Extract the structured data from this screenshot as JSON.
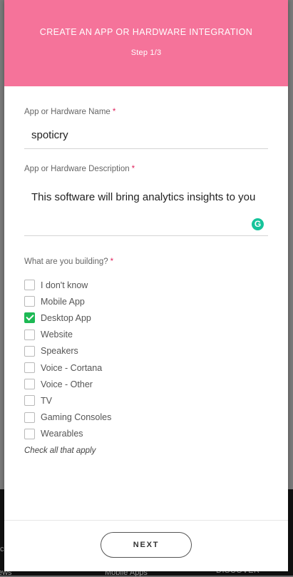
{
  "modal": {
    "title": "CREATE AN APP OR HARDWARE INTEGRATION",
    "step": "Step 1/3"
  },
  "name_field": {
    "label": "App or Hardware Name",
    "required_mark": "*",
    "value": "spoticry"
  },
  "description_field": {
    "label": "App or Hardware Description",
    "required_mark": "*",
    "value": "This software will bring analytics insights to you"
  },
  "building": {
    "label": "What are you building?",
    "required_mark": "*",
    "options": [
      {
        "label": "I don't know",
        "checked": false
      },
      {
        "label": "Mobile App",
        "checked": false
      },
      {
        "label": "Desktop App",
        "checked": true
      },
      {
        "label": "Website",
        "checked": false
      },
      {
        "label": "Speakers",
        "checked": false
      },
      {
        "label": "Voice - Cortana",
        "checked": false
      },
      {
        "label": "Voice - Other",
        "checked": false
      },
      {
        "label": "TV",
        "checked": false
      },
      {
        "label": "Gaming Consoles",
        "checked": false
      },
      {
        "label": "Wearables",
        "checked": false
      }
    ],
    "hint": "Check all that apply"
  },
  "next_button": "NEXT",
  "background": {
    "items": [
      "ews",
      "Mobile Apps",
      "DISCOVER",
      "c"
    ]
  },
  "colors": {
    "header": "#f5739a",
    "check": "#1db954",
    "grammarly": "#15c39a"
  }
}
